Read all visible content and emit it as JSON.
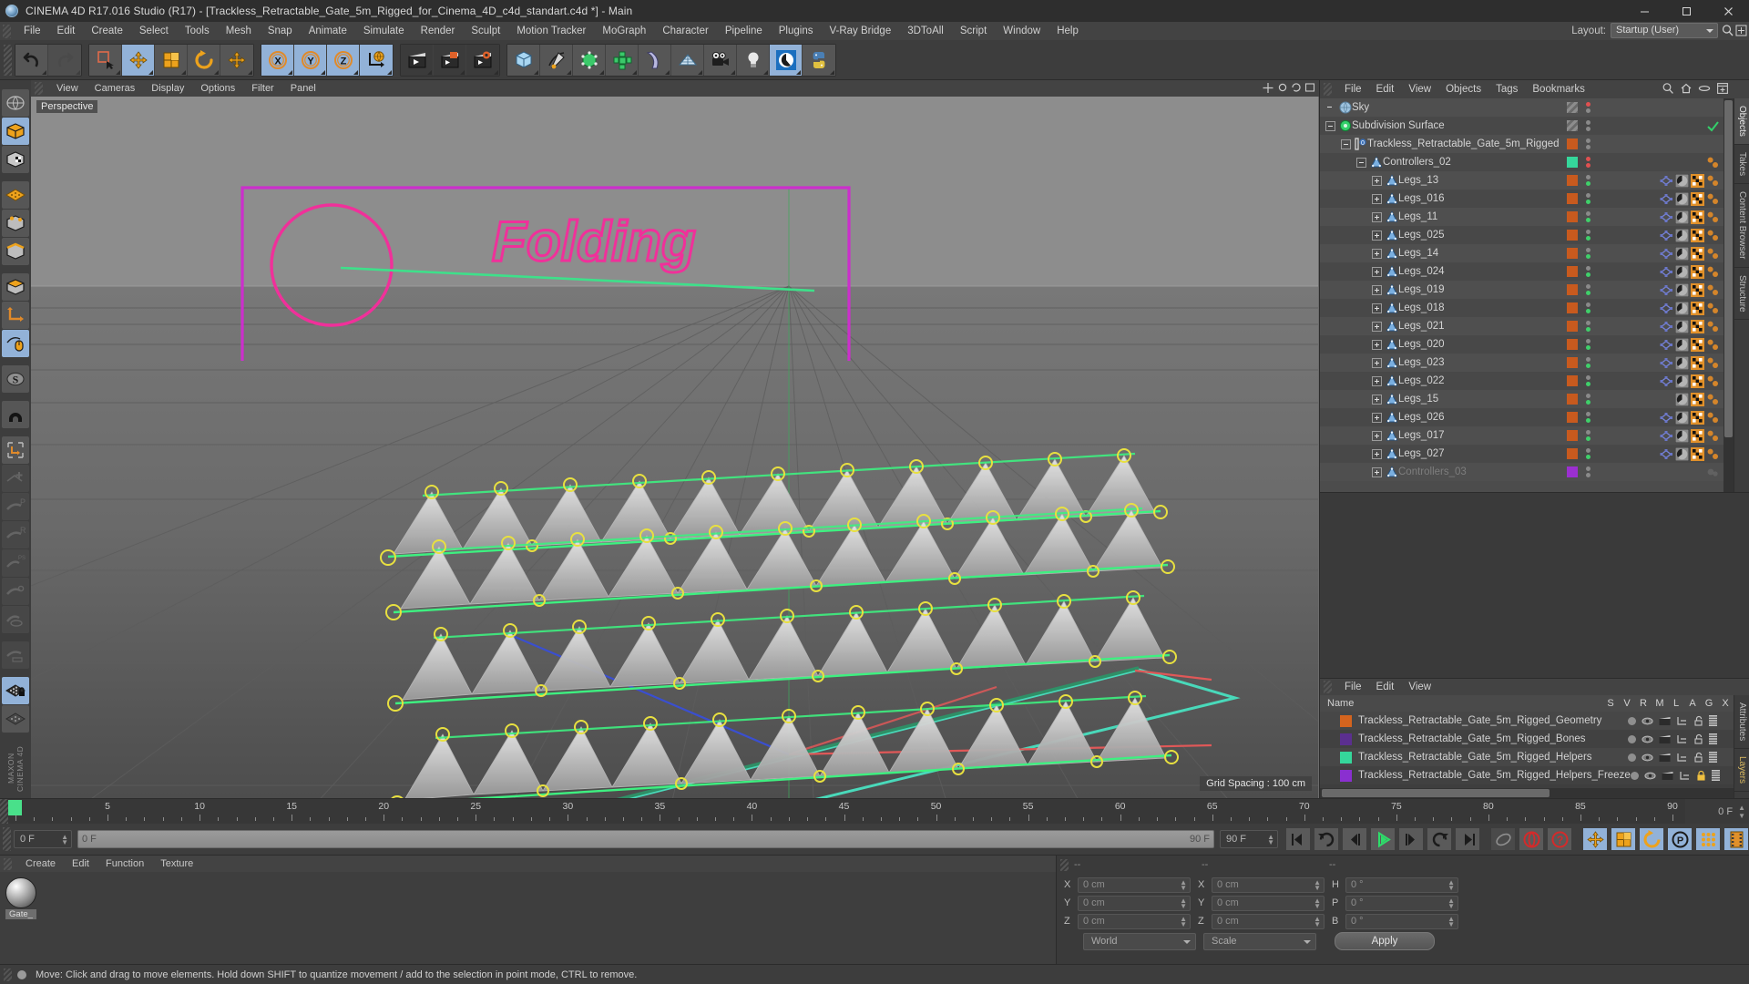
{
  "window": {
    "title": "CINEMA 4D R17.016 Studio (R17) - [Trackless_Retractable_Gate_5m_Rigged_for_Cinema_4D_c4d_standart.c4d *] - Main",
    "app_icon": "c4d-sphere-icon",
    "minimize": "–",
    "maximize": "□",
    "close": "✕"
  },
  "menubar": {
    "items": [
      "File",
      "Edit",
      "Create",
      "Select",
      "Tools",
      "Mesh",
      "Snap",
      "Animate",
      "Simulate",
      "Render",
      "Sculpt",
      "Motion Tracker",
      "MoGraph",
      "Character",
      "Pipeline",
      "Plugins",
      "V-Ray Bridge",
      "3DToAll",
      "Script",
      "Window",
      "Help"
    ],
    "layout_label": "Layout:",
    "layout_value": "Startup (User)"
  },
  "toolbar": {
    "groups": [
      {
        "name": "history",
        "buttons": [
          {
            "name": "undo-button",
            "icon": "undo-arrow-icon",
            "state": "normal"
          },
          {
            "name": "redo-button",
            "icon": "redo-arrow-icon",
            "state": "disabled"
          }
        ]
      },
      {
        "name": "selection",
        "buttons": [
          {
            "name": "live-selection-button",
            "icon": "live-selection-icon",
            "state": "normal"
          },
          {
            "name": "move-tool-button",
            "icon": "move-arrows-icon",
            "state": "active"
          },
          {
            "name": "scale-tool-button",
            "icon": "scale-box-icon",
            "state": "normal"
          },
          {
            "name": "rotate-tool-button",
            "icon": "rotate-circle-icon",
            "state": "normal"
          },
          {
            "name": "move-dup-button",
            "icon": "move-arrows-icon",
            "state": "normal"
          }
        ]
      },
      {
        "name": "axes",
        "buttons": [
          {
            "name": "x-axis-button",
            "icon": "x-axis-icon",
            "state": "active"
          },
          {
            "name": "y-axis-button",
            "icon": "y-axis-icon",
            "state": "active"
          },
          {
            "name": "z-axis-button",
            "icon": "z-axis-icon",
            "state": "active"
          },
          {
            "name": "world-coordinates-button",
            "icon": "globe-axis-icon",
            "state": "active"
          }
        ]
      },
      {
        "name": "render",
        "buttons": [
          {
            "name": "render-view-button",
            "icon": "clapperboard-icon",
            "state": "dark"
          },
          {
            "name": "render-region-button",
            "icon": "clapperboard-region-icon",
            "state": "dark"
          },
          {
            "name": "render-settings-button",
            "icon": "clapperboard-gear-icon",
            "state": "dark"
          }
        ]
      },
      {
        "name": "objects",
        "buttons": [
          {
            "name": "add-cube-button",
            "icon": "cube-icon",
            "state": "normal"
          },
          {
            "name": "add-spline-button",
            "icon": "pen-spline-icon",
            "state": "normal"
          },
          {
            "name": "add-generator-button",
            "icon": "green-cube-icon",
            "state": "normal"
          },
          {
            "name": "add-array-button",
            "icon": "mograph-cluster-icon",
            "state": "normal"
          },
          {
            "name": "add-bend-button",
            "icon": "bend-deformer-icon",
            "state": "normal"
          },
          {
            "name": "add-floor-button",
            "icon": "floor-grid-icon",
            "state": "normal"
          },
          {
            "name": "add-camera-button",
            "icon": "camera-icon",
            "state": "normal"
          },
          {
            "name": "add-light-button",
            "icon": "lightbulb-icon",
            "state": "normal"
          },
          {
            "name": "content-browser-button",
            "icon": "c4d-logo-icon",
            "state": "active"
          },
          {
            "name": "python-button",
            "icon": "python-icon",
            "state": "normal"
          }
        ]
      }
    ]
  },
  "lefttools": {
    "buttons": [
      {
        "name": "viewport-shading-button",
        "icon": "globe-wire-icon",
        "state": "dark"
      },
      {
        "name": "model-mode-button",
        "icon": "orange-box-icon",
        "state": "active"
      },
      {
        "name": "texture-mode-button",
        "icon": "checker-box-icon",
        "state": "normal"
      },
      {
        "name": "workplane-mode-button",
        "icon": "orange-grid-icon",
        "state": "normal"
      },
      {
        "name": "point-mode-button",
        "icon": "points-box-icon",
        "state": "normal"
      },
      {
        "name": "edge-mode-button",
        "icon": "edges-box-icon",
        "state": "normal"
      },
      {
        "name": "polygon-mode-button",
        "icon": "polygon-box-icon",
        "state": "normal"
      },
      {
        "name": "object-axis-button",
        "icon": "axis-corner-icon",
        "state": "normal"
      },
      {
        "name": "enable-axis-button",
        "icon": "mouse-axis-icon",
        "state": "active"
      },
      {
        "name": "snap-button",
        "icon": "snap-s-icon",
        "state": "normal"
      },
      {
        "name": "magnet-button",
        "icon": "magnet-icon",
        "state": "dark"
      },
      {
        "name": "workplane-lock-button",
        "icon": "workplane-corner-icon",
        "state": "normal"
      },
      {
        "name": "animation-layout-button",
        "icon": "keyframe-plus-icon",
        "state": "disabled"
      },
      {
        "name": "record-position-button",
        "icon": "key-p-icon",
        "state": "disabled"
      },
      {
        "name": "record-rotation-button",
        "icon": "key-r-icon",
        "state": "disabled"
      },
      {
        "name": "record-psr-button",
        "icon": "key-psr-icon",
        "state": "disabled"
      },
      {
        "name": "record-point-button",
        "icon": "key-point-icon",
        "state": "disabled"
      },
      {
        "name": "autokeying-button",
        "icon": "key-auto-icon",
        "state": "disabled"
      },
      {
        "name": "keyframe-selection-button",
        "icon": "key-selection-icon",
        "state": "disabled"
      },
      {
        "name": "lock-workplane-button",
        "icon": "grid-lock-icon",
        "state": "active"
      },
      {
        "name": "workplane-extra-button",
        "icon": "grid-dots-icon",
        "state": "normal"
      }
    ],
    "brand": "MAXON CINEMA 4D"
  },
  "viewport": {
    "menu": [
      "View",
      "Cameras",
      "Display",
      "Options",
      "Filter",
      "Panel"
    ],
    "label": "Perspective",
    "grid_spacing": "Grid Spacing : 100 cm",
    "annotation_text": "Folding",
    "colors": {
      "annotation": "#f0309a",
      "frame": "#cc2fcc",
      "spline_green": "#3ef080",
      "spline_teal": "#49e0c0",
      "x_axis": "#e04040",
      "y_axis": "#49e08a",
      "z_axis": "#4060e0",
      "point_marker": "#e8e040",
      "ground_top": "#7a7a7a",
      "ground_bottom": "#4a4a4a",
      "sky": "#8d8d8d"
    }
  },
  "objectmanager": {
    "menu": [
      "File",
      "Edit",
      "View",
      "Objects",
      "Tags",
      "Bookmarks"
    ],
    "icons": [
      "search-icon",
      "home-icon",
      "ellipse-icon",
      "add-layer-icon"
    ],
    "sidetabs": [
      {
        "label": "Objects",
        "active": true
      },
      {
        "label": "Takes",
        "active": false
      },
      {
        "label": "Content Browser",
        "active": false
      },
      {
        "label": "Structure",
        "active": false
      }
    ],
    "rows": [
      {
        "name": "Sky",
        "depth": 0,
        "expander": "none",
        "icon": "sky-sphere-icon",
        "swatch": "",
        "dots": [
          "#e05050",
          "#8a8a8a"
        ],
        "tags": [],
        "dim": false
      },
      {
        "name": "Subdivision Surface",
        "depth": 0,
        "expander": "minus",
        "icon": "subdivision-icon",
        "swatch": "",
        "dots": [
          "#8a8a8a",
          "#8a8a8a"
        ],
        "tags": [
          "check-icon"
        ],
        "dim": false
      },
      {
        "name": "Trackless_Retractable_Gate_5m_Rigged",
        "depth": 1,
        "expander": "minus",
        "icon": "null-zero-icon",
        "swatch": "#c85a1e",
        "dots": [
          "#8a8a8a",
          "#8a8a8a"
        ],
        "tags": [],
        "dim": false
      },
      {
        "name": "Controllers_02",
        "depth": 2,
        "expander": "minus",
        "icon": "joint-icon",
        "swatch": "#35d79b",
        "dots": [
          "#e05050",
          "#e05050"
        ],
        "tags": [
          "dot-pair-icon"
        ],
        "dim": false
      },
      {
        "name": "Legs_13",
        "depth": 3,
        "expander": "plus",
        "icon": "joint-icon",
        "swatch": "#c85a1e",
        "dots": [
          "#8a8a8a",
          "#3fd06a"
        ],
        "tags": [
          "constraint-icon",
          "material-sphere-icon",
          "checker-icon",
          "dot-pair-icon"
        ],
        "dim": false
      },
      {
        "name": "Legs_016",
        "depth": 3,
        "expander": "plus",
        "icon": "joint-icon",
        "swatch": "#c85a1e",
        "dots": [
          "#8a8a8a",
          "#3fd06a"
        ],
        "tags": [
          "constraint-icon",
          "material-sphere-icon",
          "checker-icon",
          "dot-pair-icon"
        ],
        "dim": false
      },
      {
        "name": "Legs_11",
        "depth": 3,
        "expander": "plus",
        "icon": "joint-icon",
        "swatch": "#c85a1e",
        "dots": [
          "#8a8a8a",
          "#3fd06a"
        ],
        "tags": [
          "constraint-icon",
          "material-sphere-icon",
          "checker-icon",
          "dot-pair-icon"
        ],
        "dim": false
      },
      {
        "name": "Legs_025",
        "depth": 3,
        "expander": "plus",
        "icon": "joint-icon",
        "swatch": "#c85a1e",
        "dots": [
          "#8a8a8a",
          "#3fd06a"
        ],
        "tags": [
          "constraint-icon",
          "material-sphere-icon",
          "checker-icon",
          "dot-pair-icon"
        ],
        "dim": false
      },
      {
        "name": "Legs_14",
        "depth": 3,
        "expander": "plus",
        "icon": "joint-icon",
        "swatch": "#c85a1e",
        "dots": [
          "#8a8a8a",
          "#3fd06a"
        ],
        "tags": [
          "constraint-icon",
          "material-sphere-icon",
          "checker-icon",
          "dot-pair-icon"
        ],
        "dim": false
      },
      {
        "name": "Legs_024",
        "depth": 3,
        "expander": "plus",
        "icon": "joint-icon",
        "swatch": "#c85a1e",
        "dots": [
          "#8a8a8a",
          "#3fd06a"
        ],
        "tags": [
          "constraint-icon",
          "material-sphere-icon",
          "checker-icon",
          "dot-pair-icon"
        ],
        "dim": false
      },
      {
        "name": "Legs_019",
        "depth": 3,
        "expander": "plus",
        "icon": "joint-icon",
        "swatch": "#c85a1e",
        "dots": [
          "#8a8a8a",
          "#3fd06a"
        ],
        "tags": [
          "constraint-icon",
          "material-sphere-icon",
          "checker-icon",
          "dot-pair-icon"
        ],
        "dim": false
      },
      {
        "name": "Legs_018",
        "depth": 3,
        "expander": "plus",
        "icon": "joint-icon",
        "swatch": "#c85a1e",
        "dots": [
          "#8a8a8a",
          "#3fd06a"
        ],
        "tags": [
          "constraint-icon",
          "material-sphere-icon",
          "checker-icon",
          "dot-pair-icon"
        ],
        "dim": false
      },
      {
        "name": "Legs_021",
        "depth": 3,
        "expander": "plus",
        "icon": "joint-icon",
        "swatch": "#c85a1e",
        "dots": [
          "#8a8a8a",
          "#3fd06a"
        ],
        "tags": [
          "constraint-icon",
          "material-sphere-icon",
          "checker-icon",
          "dot-pair-icon"
        ],
        "dim": false
      },
      {
        "name": "Legs_020",
        "depth": 3,
        "expander": "plus",
        "icon": "joint-icon",
        "swatch": "#c85a1e",
        "dots": [
          "#8a8a8a",
          "#3fd06a"
        ],
        "tags": [
          "constraint-icon",
          "material-sphere-icon",
          "checker-icon",
          "dot-pair-icon"
        ],
        "dim": false
      },
      {
        "name": "Legs_023",
        "depth": 3,
        "expander": "plus",
        "icon": "joint-icon",
        "swatch": "#c85a1e",
        "dots": [
          "#8a8a8a",
          "#3fd06a"
        ],
        "tags": [
          "constraint-icon",
          "material-sphere-icon",
          "checker-icon",
          "dot-pair-icon"
        ],
        "dim": false
      },
      {
        "name": "Legs_022",
        "depth": 3,
        "expander": "plus",
        "icon": "joint-icon",
        "swatch": "#c85a1e",
        "dots": [
          "#8a8a8a",
          "#3fd06a"
        ],
        "tags": [
          "constraint-icon",
          "material-sphere-icon",
          "checker-icon",
          "dot-pair-icon"
        ],
        "dim": false
      },
      {
        "name": "Legs_15",
        "depth": 3,
        "expander": "plus",
        "icon": "joint-icon",
        "swatch": "#c85a1e",
        "dots": [
          "#8a8a8a",
          "#3fd06a"
        ],
        "tags": [
          "material-sphere-icon",
          "checker-icon",
          "dot-pair-icon"
        ],
        "dim": false
      },
      {
        "name": "Legs_026",
        "depth": 3,
        "expander": "plus",
        "icon": "joint-icon",
        "swatch": "#c85a1e",
        "dots": [
          "#8a8a8a",
          "#3fd06a"
        ],
        "tags": [
          "constraint-icon",
          "material-sphere-icon",
          "checker-icon",
          "dot-pair-icon"
        ],
        "dim": false
      },
      {
        "name": "Legs_017",
        "depth": 3,
        "expander": "plus",
        "icon": "joint-icon",
        "swatch": "#c85a1e",
        "dots": [
          "#8a8a8a",
          "#3fd06a"
        ],
        "tags": [
          "constraint-icon",
          "material-sphere-icon",
          "checker-icon",
          "dot-pair-icon"
        ],
        "dim": false
      },
      {
        "name": "Legs_027",
        "depth": 3,
        "expander": "plus",
        "icon": "joint-icon",
        "swatch": "#c85a1e",
        "dots": [
          "#8a8a8a",
          "#3fd06a"
        ],
        "tags": [
          "constraint-icon",
          "material-sphere-icon",
          "checker-icon",
          "dot-pair-icon"
        ],
        "dim": false
      },
      {
        "name": "Controllers_03",
        "depth": 3,
        "expander": "plus",
        "icon": "joint-icon",
        "swatch": "#9b2fd0",
        "dots": [
          "#8a8a8a",
          "#8a8a8a"
        ],
        "tags": [
          "ghost-icon"
        ],
        "dim": true
      }
    ]
  },
  "layermanager": {
    "menu": [
      "File",
      "Edit",
      "View"
    ],
    "columns": [
      "Name",
      "S",
      "V",
      "R",
      "M",
      "L",
      "A",
      "G",
      "X"
    ],
    "sidetabs": [
      {
        "label": "Attributes",
        "active": false
      },
      {
        "label": "Layers",
        "active": true
      }
    ],
    "rows": [
      {
        "name": "Trackless_Retractable_Gate_5m_Rigged_Geometry",
        "color": "#d4641e",
        "locked": false
      },
      {
        "name": "Trackless_Retractable_Gate_5m_Rigged_Bones",
        "color": "#5b2f8f",
        "locked": false
      },
      {
        "name": "Trackless_Retractable_Gate_5m_Rigged_Helpers",
        "color": "#35d79b",
        "locked": false
      },
      {
        "name": "Trackless_Retractable_Gate_5m_Rigged_Helpers_Freeze",
        "color": "#8a2fd0",
        "locked": true
      }
    ]
  },
  "timeline": {
    "ticks": [
      0,
      5,
      10,
      15,
      20,
      25,
      30,
      35,
      40,
      45,
      50,
      55,
      60,
      65,
      70,
      75,
      80,
      85,
      90
    ],
    "range_start": 0,
    "range_end": 90,
    "current_frame_field": "0 F",
    "current_frame_right": "0 F",
    "scrubber_left": "0 F",
    "scrubber_right": "90 F",
    "end_frame_field": "90 F",
    "playhead_frame": 0
  },
  "playback": {
    "buttons": [
      {
        "name": "goto-start-button",
        "icon": "skip-start-icon",
        "state": "normal"
      },
      {
        "name": "previous-key-button",
        "icon": "prev-key-icon",
        "state": "normal"
      },
      {
        "name": "step-back-button",
        "icon": "step-back-icon",
        "state": "normal"
      },
      {
        "name": "play-button",
        "icon": "play-icon",
        "state": "normal"
      },
      {
        "name": "step-forward-button",
        "icon": "step-forward-icon",
        "state": "normal"
      },
      {
        "name": "next-key-button",
        "icon": "next-key-icon",
        "state": "normal"
      },
      {
        "name": "goto-end-button",
        "icon": "skip-end-icon",
        "state": "normal"
      },
      {
        "name": "record-active-objects-button",
        "icon": "record-key-icon",
        "state": "dim"
      },
      {
        "name": "autokeying-button",
        "icon": "autokey-circle-icon",
        "state": "normal"
      },
      {
        "name": "keyframe-help-button",
        "icon": "question-circle-icon",
        "state": "normal"
      },
      {
        "name": "record-position-button",
        "icon": "move-key-icon",
        "state": "active"
      },
      {
        "name": "record-scale-button",
        "icon": "scale-key-icon",
        "state": "active"
      },
      {
        "name": "record-rotation-button",
        "icon": "rotate-key-icon",
        "state": "active"
      },
      {
        "name": "record-param-button",
        "icon": "param-p-icon",
        "state": "active"
      },
      {
        "name": "record-pla-button",
        "icon": "pla-dots-icon",
        "state": "active"
      },
      {
        "name": "timeline-button",
        "icon": "filmstrip-icon",
        "state": "active"
      }
    ]
  },
  "materialmanager": {
    "menu": [
      "Create",
      "Edit",
      "Function",
      "Texture"
    ],
    "materials": [
      {
        "name": "Gate_",
        "preview": "material-sphere-icon"
      }
    ]
  },
  "coordinates": {
    "headers": [
      "--",
      "--",
      "--"
    ],
    "position": {
      "label_x": "X",
      "label_y": "Y",
      "label_z": "Z",
      "x": "0 cm",
      "y": "0 cm",
      "z": "0 cm"
    },
    "size": {
      "label_x": "X",
      "label_y": "Y",
      "label_z": "Z",
      "x": "0 cm",
      "y": "0 cm",
      "z": "0 cm"
    },
    "rotation": {
      "label_h": "H",
      "label_p": "P",
      "label_b": "B",
      "h": "0 °",
      "p": "0 °",
      "b": "0 °"
    },
    "system_dropdown": "World",
    "mode_dropdown": "Scale",
    "apply_label": "Apply"
  },
  "statusbar": {
    "message": "Move: Click and drag to move elements. Hold down SHIFT to quantize movement / add to the selection in point mode, CTRL to remove."
  }
}
